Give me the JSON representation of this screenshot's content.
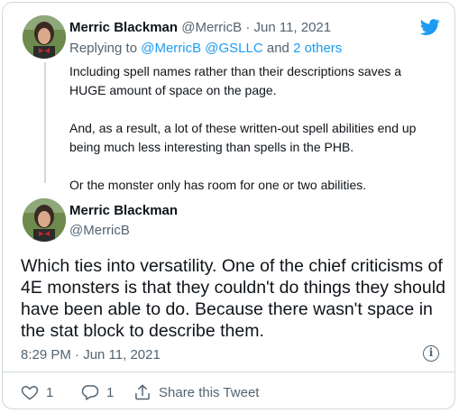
{
  "tweet1": {
    "name": "Merric Blackman",
    "handle": "@MerricB",
    "separator": "·",
    "date": "Jun 11, 2021",
    "replying_prefix": "Replying to",
    "replying_users": "@MerricB @GSLLC",
    "replying_and": "and",
    "replying_others": "2 others",
    "paragraphs": [
      "Including spell names rather than their descriptions saves a HUGE amount of space on the page.",
      "And, as a result, a lot of these written-out spell abilities end up being much less interesting than spells in the PHB.",
      "Or the monster only has room for one or two abilities."
    ]
  },
  "tweet2": {
    "name": "Merric Blackman",
    "handle": "@MerricB",
    "text": "Which ties into versatility. One of the chief criticisms of 4E monsters is that they couldn't do things they should have been able to do. Because there wasn't space in the stat block to describe them.",
    "timestamp": "8:29 PM · Jun 11, 2021",
    "info_glyph": "i"
  },
  "actions": {
    "likes": "1",
    "replies": "1",
    "share_label": "Share this Tweet"
  },
  "icons": [
    "twitter-bird-icon",
    "info-icon",
    "heart-icon",
    "reply-icon",
    "share-icon"
  ],
  "colors": {
    "brand": "#1d9bf0",
    "muted": "#536471",
    "text": "#0f1419",
    "border": "#cfd9de"
  }
}
